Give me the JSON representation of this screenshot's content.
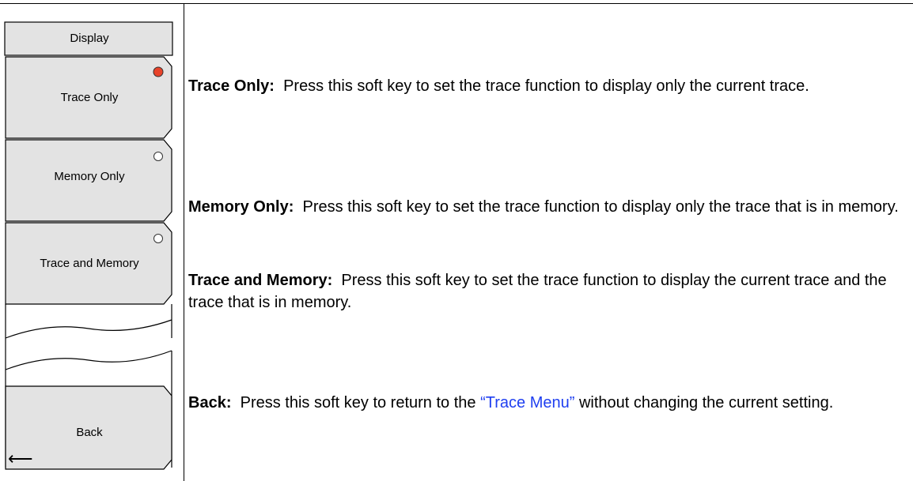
{
  "menu": {
    "title": "Display",
    "keys": [
      {
        "label": "Trace Only",
        "selected": true
      },
      {
        "label": "Memory Only",
        "selected": false
      },
      {
        "label": "Trace and Memory",
        "selected": false
      }
    ],
    "back": {
      "label": "Back",
      "arrow": "⟵"
    }
  },
  "descriptions": {
    "trace_only": {
      "term": "Trace Only:",
      "text": "Press this soft key to set the trace function to display only the current trace."
    },
    "memory_only": {
      "term": "Memory Only:",
      "text": "Press this soft key to set the trace function to display only the trace that is in memory."
    },
    "trace_and_memory": {
      "term": "Trace and Memory:",
      "text": "Press this soft key to set the trace function to display the current trace and the trace that is in memory."
    },
    "back": {
      "term": "Back:",
      "text_before": "Press this soft key to return to the",
      "link": "“Trace Menu”",
      "text_after": "without changing the current setting."
    }
  },
  "colors": {
    "selected_indicator": "#e8432a",
    "link": "#1f3ff0",
    "key_fill": "#e3e3e3"
  }
}
